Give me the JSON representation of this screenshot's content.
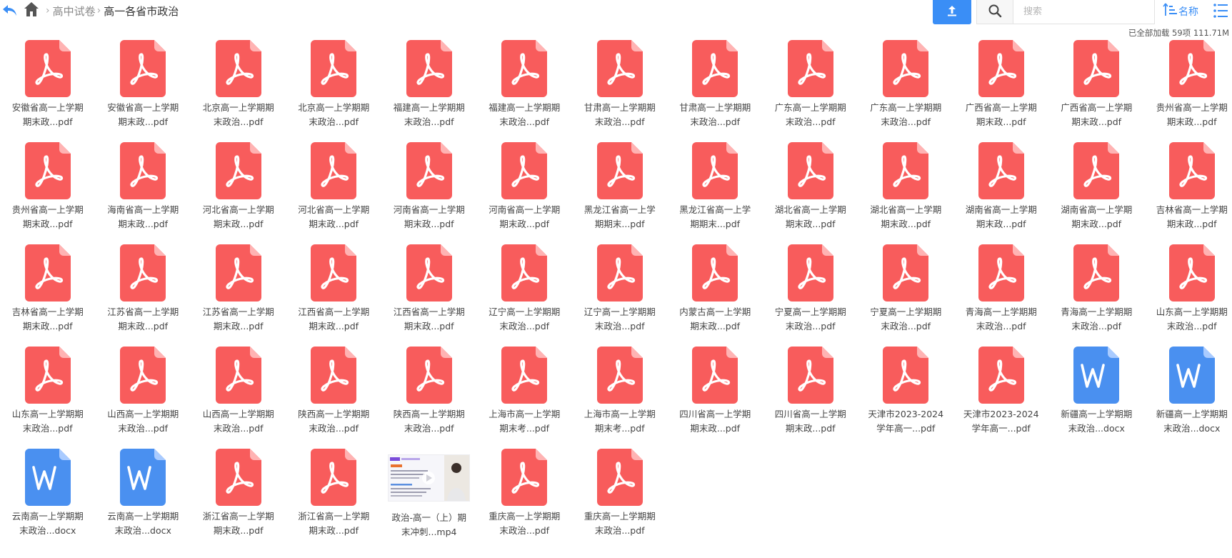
{
  "nav": {
    "back_icon": "back-arrow-icon",
    "home_icon": "home-icon",
    "breadcrumb": [
      {
        "label": "高中试卷"
      },
      {
        "label": "高一各省市政治"
      }
    ]
  },
  "toolbar": {
    "upload_icon": "upload-icon",
    "search_icon": "search-icon",
    "search_placeholder": "搜索",
    "sort_label": "名称",
    "sort_icon": "sort-ascending-icon",
    "view_icon": "list-view-icon"
  },
  "status": {
    "text": "已全部加载 59项 111.71M"
  },
  "colors": {
    "accent": "#3a8ef6",
    "pdf": "#f85c5c",
    "word": "#4a90f0"
  },
  "files": [
    {
      "type": "pdf",
      "l1": "安徽省高一上学期",
      "l2": "期末政...pdf"
    },
    {
      "type": "pdf",
      "l1": "安徽省高一上学期",
      "l2": "期末政...pdf"
    },
    {
      "type": "pdf",
      "l1": "北京高一上学期期",
      "l2": "末政治...pdf"
    },
    {
      "type": "pdf",
      "l1": "北京高一上学期期",
      "l2": "末政治...pdf"
    },
    {
      "type": "pdf",
      "l1": "福建高一上学期期",
      "l2": "末政治...pdf"
    },
    {
      "type": "pdf",
      "l1": "福建高一上学期期",
      "l2": "末政治...pdf"
    },
    {
      "type": "pdf",
      "l1": "甘肃高一上学期期",
      "l2": "末政治...pdf"
    },
    {
      "type": "pdf",
      "l1": "甘肃高一上学期期",
      "l2": "末政治...pdf"
    },
    {
      "type": "pdf",
      "l1": "广东高一上学期期",
      "l2": "末政治...pdf"
    },
    {
      "type": "pdf",
      "l1": "广东高一上学期期",
      "l2": "末政治...pdf"
    },
    {
      "type": "pdf",
      "l1": "广西省高一上学期",
      "l2": "期末政...pdf"
    },
    {
      "type": "pdf",
      "l1": "广西省高一上学期",
      "l2": "期末政...pdf"
    },
    {
      "type": "pdf",
      "l1": "贵州省高一上学期",
      "l2": "期末政...pdf"
    },
    {
      "type": "pdf",
      "l1": "贵州省高一上学期",
      "l2": "期末政...pdf"
    },
    {
      "type": "pdf",
      "l1": "海南省高一上学期",
      "l2": "期末政...pdf"
    },
    {
      "type": "pdf",
      "l1": "河北省高一上学期",
      "l2": "期末政...pdf"
    },
    {
      "type": "pdf",
      "l1": "河北省高一上学期",
      "l2": "期末政...pdf"
    },
    {
      "type": "pdf",
      "l1": "河南省高一上学期",
      "l2": "期末政...pdf"
    },
    {
      "type": "pdf",
      "l1": "河南省高一上学期",
      "l2": "期末政...pdf"
    },
    {
      "type": "pdf",
      "l1": "黑龙江省高一上学",
      "l2": "期期末...pdf"
    },
    {
      "type": "pdf",
      "l1": "黑龙江省高一上学",
      "l2": "期期末...pdf"
    },
    {
      "type": "pdf",
      "l1": "湖北省高一上学期",
      "l2": "期末政...pdf"
    },
    {
      "type": "pdf",
      "l1": "湖北省高一上学期",
      "l2": "期末政...pdf"
    },
    {
      "type": "pdf",
      "l1": "湖南省高一上学期",
      "l2": "期末政...pdf"
    },
    {
      "type": "pdf",
      "l1": "湖南省高一上学期",
      "l2": "期末政...pdf"
    },
    {
      "type": "pdf",
      "l1": "吉林省高一上学期",
      "l2": "期末政...pdf"
    },
    {
      "type": "pdf",
      "l1": "吉林省高一上学期",
      "l2": "期末政...pdf"
    },
    {
      "type": "pdf",
      "l1": "江苏省高一上学期",
      "l2": "期末政...pdf"
    },
    {
      "type": "pdf",
      "l1": "江苏省高一上学期",
      "l2": "期末政...pdf"
    },
    {
      "type": "pdf",
      "l1": "江西省高一上学期",
      "l2": "期末政...pdf"
    },
    {
      "type": "pdf",
      "l1": "江西省高一上学期",
      "l2": "期末政...pdf"
    },
    {
      "type": "pdf",
      "l1": "辽宁高一上学期期",
      "l2": "末政治...pdf"
    },
    {
      "type": "pdf",
      "l1": "辽宁高一上学期期",
      "l2": "末政治...pdf"
    },
    {
      "type": "pdf",
      "l1": "内蒙古高一上学期",
      "l2": "期末政...pdf"
    },
    {
      "type": "pdf",
      "l1": "宁夏高一上学期期",
      "l2": "末政治...pdf"
    },
    {
      "type": "pdf",
      "l1": "宁夏高一上学期期",
      "l2": "末政治...pdf"
    },
    {
      "type": "pdf",
      "l1": "青海高一上学期期",
      "l2": "末政治...pdf"
    },
    {
      "type": "pdf",
      "l1": "青海高一上学期期",
      "l2": "末政治...pdf"
    },
    {
      "type": "pdf",
      "l1": "山东高一上学期期",
      "l2": "末政治...pdf"
    },
    {
      "type": "pdf",
      "l1": "山东高一上学期期",
      "l2": "末政治...pdf"
    },
    {
      "type": "pdf",
      "l1": "山西高一上学期期",
      "l2": "末政治...pdf"
    },
    {
      "type": "pdf",
      "l1": "山西高一上学期期",
      "l2": "末政治...pdf"
    },
    {
      "type": "pdf",
      "l1": "陕西高一上学期期",
      "l2": "末政治...pdf"
    },
    {
      "type": "pdf",
      "l1": "陕西高一上学期期",
      "l2": "末政治...pdf"
    },
    {
      "type": "pdf",
      "l1": "上海市高一上学期",
      "l2": "期末考...pdf"
    },
    {
      "type": "pdf",
      "l1": "上海市高一上学期",
      "l2": "期末考...pdf"
    },
    {
      "type": "pdf",
      "l1": "四川省高一上学期",
      "l2": "期末政...pdf"
    },
    {
      "type": "pdf",
      "l1": "四川省高一上学期",
      "l2": "期末政...pdf"
    },
    {
      "type": "pdf",
      "l1": "天津市2023-2024",
      "l2": "学年高一...pdf"
    },
    {
      "type": "pdf",
      "l1": "天津市2023-2024",
      "l2": "学年高一...pdf"
    },
    {
      "type": "docx",
      "l1": "新疆高一上学期期",
      "l2": "末政治...docx"
    },
    {
      "type": "docx",
      "l1": "新疆高一上学期期",
      "l2": "末政治...docx"
    },
    {
      "type": "docx",
      "l1": "云南高一上学期期",
      "l2": "末政治...docx"
    },
    {
      "type": "docx",
      "l1": "云南高一上学期期",
      "l2": "末政治...docx"
    },
    {
      "type": "pdf",
      "l1": "浙江省高一上学期",
      "l2": "期末政...pdf"
    },
    {
      "type": "pdf",
      "l1": "浙江省高一上学期",
      "l2": "期末政...pdf"
    },
    {
      "type": "mp4",
      "l1": "政治-高一（上）期",
      "l2": "末冲刺...mp4"
    },
    {
      "type": "pdf",
      "l1": "重庆高一上学期期",
      "l2": "末政治...pdf"
    },
    {
      "type": "pdf",
      "l1": "重庆高一上学期期",
      "l2": "末政治...pdf"
    }
  ]
}
